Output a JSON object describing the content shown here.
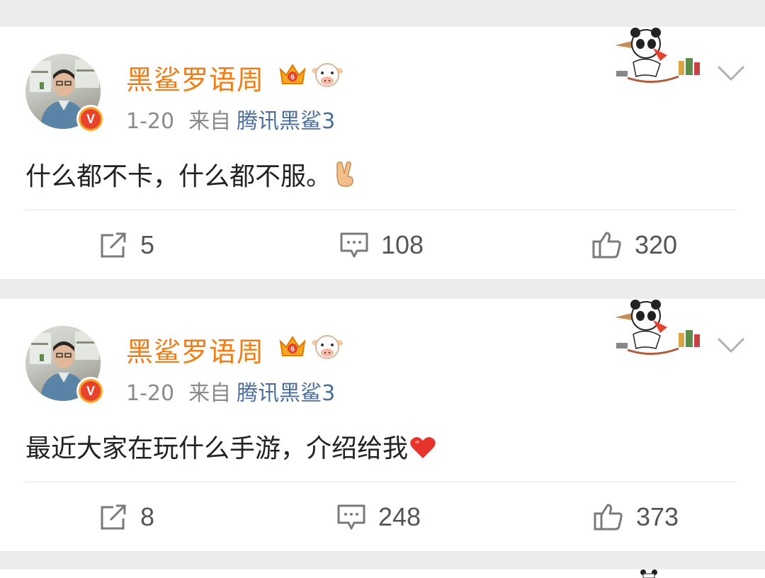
{
  "posts": [
    {
      "username": "黑鲨罗语周",
      "date": "1-20",
      "from_label": "来自",
      "source": "腾讯黑鲨3",
      "verified_badge": "V",
      "content": "什么都不卡，什么都不服。",
      "content_emoji": "victory-hand-icon",
      "reposts": "5",
      "comments": "108",
      "likes": "320"
    },
    {
      "username": "黑鲨罗语周",
      "date": "1-20",
      "from_label": "来自",
      "source": "腾讯黑鲨3",
      "verified_badge": "V",
      "content": "最近大家在玩什么手游，介绍给我",
      "content_emoji": "red-heart-icon",
      "reposts": "8",
      "comments": "248",
      "likes": "373"
    }
  ],
  "colors": {
    "username": "#f07c12",
    "source_link": "#4a6f9c",
    "meta": "#8a8a8a",
    "background": "#ececec",
    "card": "#ffffff"
  }
}
